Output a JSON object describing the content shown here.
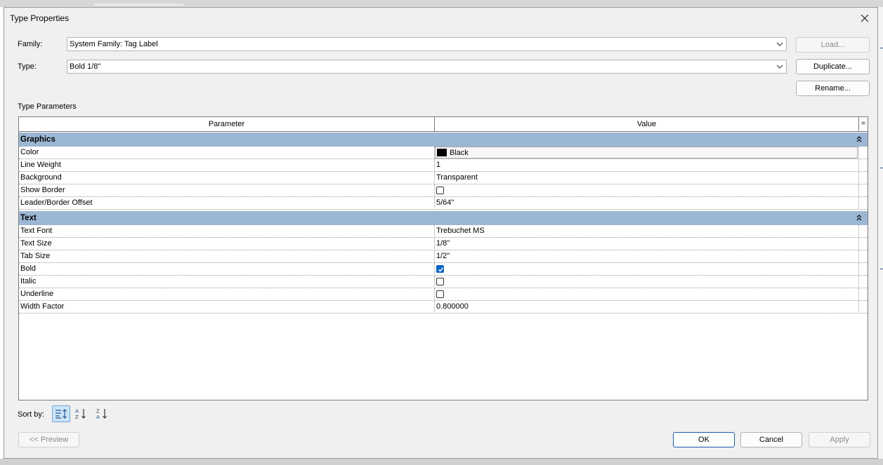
{
  "dialog": {
    "title": "Type Properties"
  },
  "family": {
    "label": "Family:",
    "value": "System Family: Tag Label"
  },
  "type": {
    "label": "Type:",
    "value": "Bold 1/8\""
  },
  "buttons": {
    "load": "Load...",
    "duplicate": "Duplicate...",
    "rename": "Rename...",
    "preview": "<< Preview",
    "ok": "OK",
    "cancel": "Cancel",
    "apply": "Apply"
  },
  "section_label": "Type Parameters",
  "table": {
    "col_parameter": "Parameter",
    "col_value": "Value",
    "col_eq": "=",
    "groups": [
      {
        "name": "Graphics",
        "rows": [
          {
            "param": "Color",
            "value": "Black",
            "swatch_color": "#000000"
          },
          {
            "param": "Line Weight",
            "value": "1"
          },
          {
            "param": "Background",
            "value": "Transparent"
          },
          {
            "param": "Show Border",
            "checked": false
          },
          {
            "param": "Leader/Border Offset",
            "value": "5/64\""
          }
        ]
      },
      {
        "name": "Text",
        "rows": [
          {
            "param": "Text Font",
            "value": "Trebuchet MS"
          },
          {
            "param": "Text Size",
            "value": "1/8\""
          },
          {
            "param": "Tab Size",
            "value": "1/2\""
          },
          {
            "param": "Bold",
            "checked": true
          },
          {
            "param": "Italic",
            "checked": false
          },
          {
            "param": "Underline",
            "checked": false
          },
          {
            "param": "Width Factor",
            "value": "0.800000"
          }
        ]
      }
    ]
  },
  "sort": {
    "label": "Sort by:",
    "icons": [
      "group-sort-icon",
      "sort-a-z-icon",
      "sort-z-a-icon"
    ]
  },
  "colors": {
    "group_header": "#9cb7d4",
    "checkbox_checked": "#0a66c2",
    "ok_border": "#1a5ca8"
  }
}
